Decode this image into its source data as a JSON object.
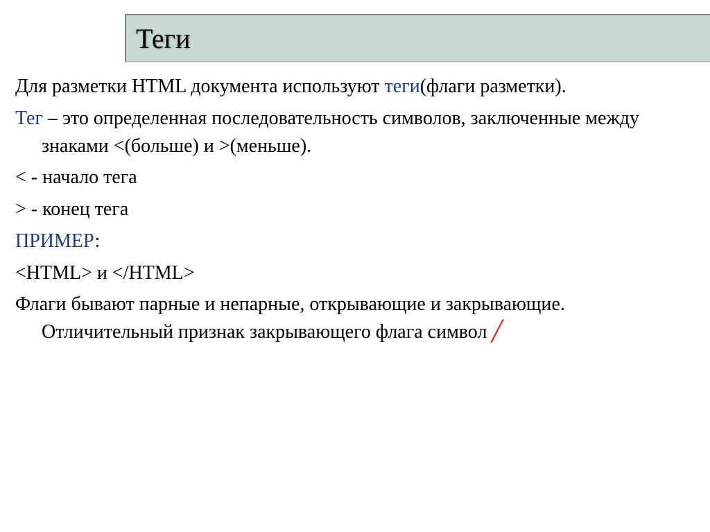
{
  "title": "Теги",
  "p1_a": "Для разметки HTML документа используют ",
  "p1_b": "теги",
  "p1_c": "(флаги разметки).",
  "p2_a": "Тег",
  "p2_b": " – это определенная последовательность символов, заключенные между знаками <(больше)  и >(меньше).",
  "p3": "< - начало тега",
  "p4": "> - конец тега",
  "p5_a": "ПРИМЕР",
  "p5_b": ":",
  "p6": "<HTML> и </HTML>",
  "p7": "Флаги бывают парные и непарные, открывающие и закрывающие. Отличительный признак закрывающего флага символ ",
  "slash": "/"
}
